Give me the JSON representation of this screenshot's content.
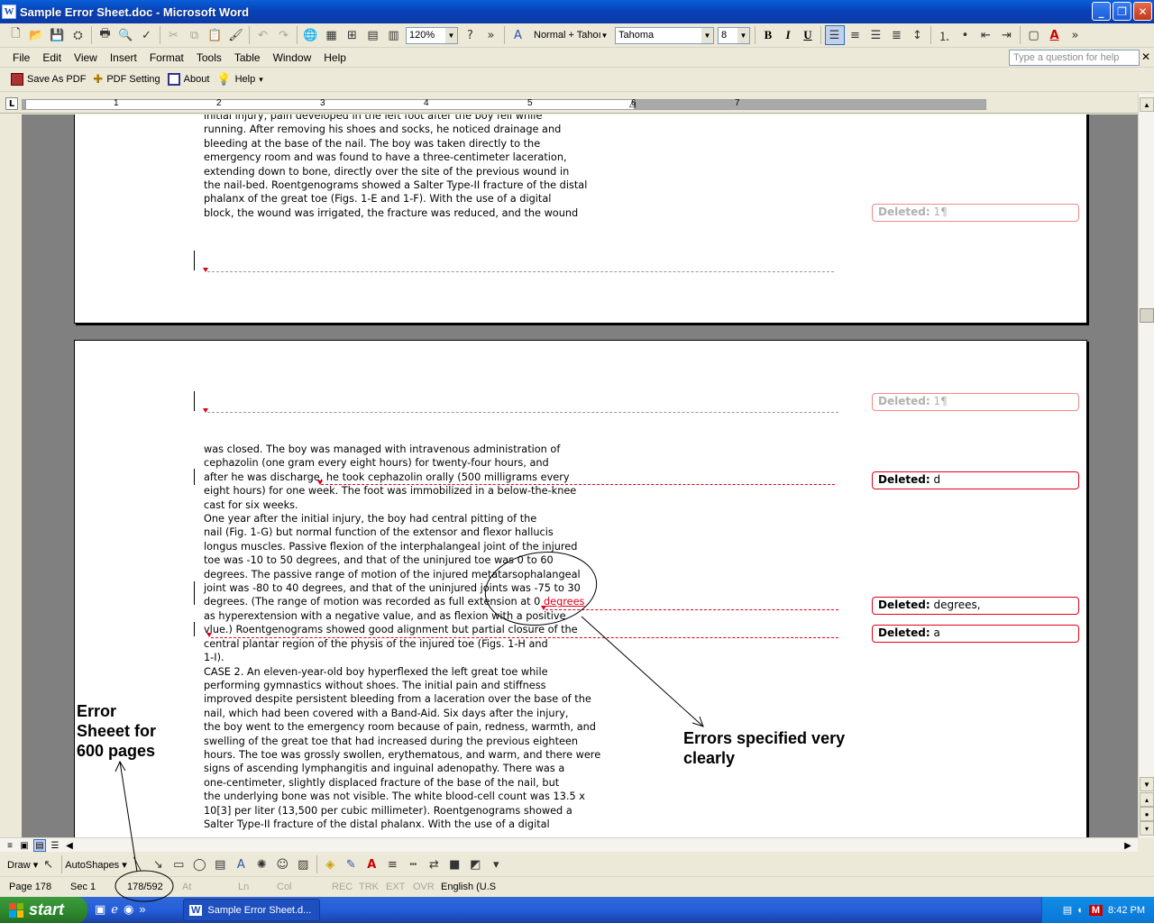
{
  "window": {
    "title": "Sample Error Sheet.doc - Microsoft Word",
    "app_icon_letter": "W",
    "minimize": "_",
    "maximize": "❐",
    "close": "✕"
  },
  "standard_toolbar": {
    "zoom": "120%",
    "style": "Normal + Tahoı",
    "font": "Tahoma",
    "size": "8",
    "bold": "B",
    "italic": "I",
    "underline": "U"
  },
  "menubar": {
    "items": [
      "File",
      "Edit",
      "View",
      "Insert",
      "Format",
      "Tools",
      "Table",
      "Window",
      "Help"
    ],
    "help_placeholder": "Type a question for help",
    "close": "✕"
  },
  "pdf_toolbar": {
    "save_as_pdf": "Save As PDF",
    "pdf_setting": "PDF Setting",
    "about": "About",
    "help": "Help"
  },
  "ruler": {
    "numbers": [
      "1",
      "2",
      "3",
      "4",
      "5",
      "6",
      "7"
    ]
  },
  "document": {
    "page1_lines": [
      "initial injury, pain developed in the left foot after the boy fell while",
      "running. After removing his shoes and socks, he noticed drainage and",
      "bleeding at the base of the nail. The boy was taken directly to the",
      "emergency room and was found to have a three-centimeter laceration,",
      "extending down to bone, directly over the site of the previous wound in",
      "the nail-bed. Roentgenograms showed a Salter Type-II fracture of the distal",
      "phalanx of the great toe (Figs. 1-E and 1-F). With the use of a digital",
      "block, the wound was irrigated, the fracture was reduced, and the wound"
    ],
    "page2_lines_a": [
      "was closed. The boy was managed with intravenous administration of",
      "cephazolin (one gram every eight hours) for twenty-four hours, and",
      "after he was discharge, he took cephazolin orally (500 milligrams every",
      "eight hours) for one week. The foot was immobilized in a below-the-knee",
      "cast for six weeks.",
      "One year after the initial injury, the boy had central pitting of the",
      "nail (Fig. 1-G) but normal function of the extensor and flexor hallucis",
      "longus muscles. Passive flexion of the interphalangeal joint of the injured",
      "toe was -10 to 50 degrees, and that of the uninjured toe was 0 to 60",
      "degrees. The passive range of motion of the injured metatarsophalangeal",
      "joint was -80 to 40 degrees, and that of the uninjured joints was -75 to 30"
    ],
    "line_degrees_prefix": "degrees. (The range of motion was recorded as full extension at 0",
    "line_degrees_inserted": "degrees",
    "page2_lines_b": [
      "as hyperextension with a negative value, and as flexion with a positive",
      "vlue.) Roentgenograms showed good alignment but partial closure of the",
      "central plantar region of the physis of the injured toe (Figs. 1-H and",
      "1-I).",
      "CASE 2. An eleven-year-old boy hyperflexed the left great toe while",
      "performing gymnastics without shoes. The initial pain and stiffness",
      "improved despite persistent bleeding from a laceration over the base of the",
      "nail, which had been covered with a Band-Aid. Six days after the injury,",
      "the boy went to the emergency room because of pain, redness, warmth, and",
      "swelling of the great toe that had increased during the previous eighteen",
      "hours. The toe was grossly swollen, erythematous, and warm, and there were",
      "signs of ascending lymphangitis and inguinal adenopathy. There was a",
      "one-centimeter, slightly displaced fracture of the base of the nail, but",
      "the underlying bone was not visible. The white blood-cell count was 13.5 x",
      "10[3] per liter (13,500 per cubic millimeter). Roentgenograms showed a",
      "Salter Type-II fracture of the distal phalanx. With the use of a digital"
    ],
    "balloons": [
      {
        "label": "Deleted:",
        "text": "1¶"
      },
      {
        "label": "Deleted:",
        "text": "1¶"
      },
      {
        "label": "Deleted:",
        "text": "d"
      },
      {
        "label": "Deleted:",
        "text": "degrees,"
      },
      {
        "label": "Deleted:",
        "text": "a"
      }
    ]
  },
  "annotations": {
    "error_sheet": [
      "Error",
      "Sheeet for",
      "600 pages"
    ],
    "errors_specified": [
      "Errors specified very",
      "clearly"
    ]
  },
  "drawing_toolbar": {
    "draw": "Draw",
    "autoshapes": "AutoShapes"
  },
  "statusbar": {
    "page": "Page  178",
    "sec": "Sec  1",
    "page_count": "178/592",
    "at": "At",
    "ln": "Ln",
    "col": "Col",
    "rec": "REC",
    "trk": "TRK",
    "ext": "EXT",
    "ovr": "OVR",
    "language": "English (U.S"
  },
  "taskbar": {
    "start": "start",
    "task": "Sample Error Sheet.d...",
    "clock": "8:42 PM"
  },
  "colors": {
    "titlebar": "#0842b8",
    "revision_red": "#e0001b",
    "start_green": "#2f8a2f"
  }
}
